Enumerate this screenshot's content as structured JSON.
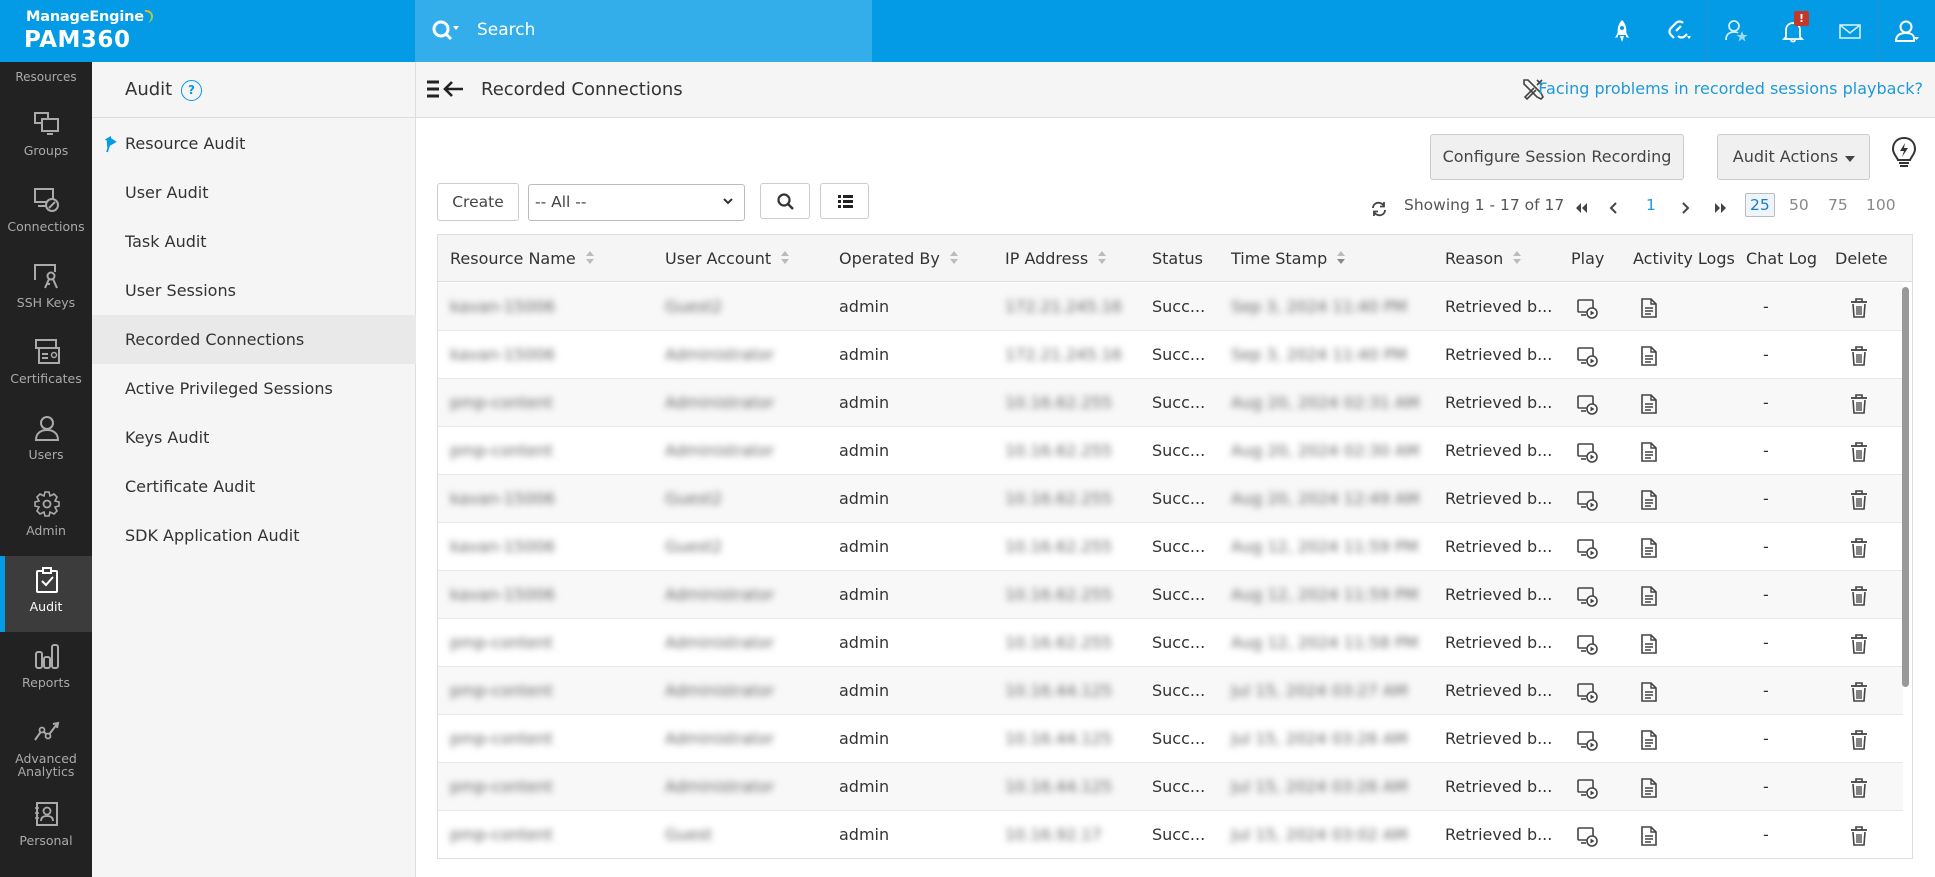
{
  "brand": {
    "vendor": "ManageEngine",
    "product": "PAM360",
    "color": "#039be5"
  },
  "search": {
    "placeholder": "Search"
  },
  "topbar_icons": [
    "rocket-icon",
    "link-icon",
    "user-star-icon",
    "bell-icon",
    "mail-icon",
    "user-icon"
  ],
  "notification_badge": "!",
  "leftnav": {
    "resources_label": "Resources",
    "items": [
      {
        "label": "Groups",
        "icon": "groups-icon"
      },
      {
        "label": "Connections",
        "icon": "connections-icon"
      },
      {
        "label": "SSH Keys",
        "icon": "ssh-keys-icon"
      },
      {
        "label": "Certificates",
        "icon": "certificates-icon"
      },
      {
        "label": "Users",
        "icon": "users-icon"
      },
      {
        "label": "Admin",
        "icon": "admin-gear-icon"
      },
      {
        "label": "Audit",
        "icon": "audit-clipboard-icon",
        "active": true
      },
      {
        "label": "Reports",
        "icon": "reports-icon"
      },
      {
        "label": "Advanced Analytics",
        "icon": "analytics-icon"
      },
      {
        "label": "Personal",
        "icon": "personal-icon"
      }
    ]
  },
  "subnav": {
    "title": "Audit",
    "help": "?",
    "items": [
      {
        "label": "Resource Audit",
        "pinned": true
      },
      {
        "label": "User Audit"
      },
      {
        "label": "Task Audit"
      },
      {
        "label": "User Sessions"
      },
      {
        "label": "Recorded Connections",
        "active": true
      },
      {
        "label": "Active Privileged Sessions"
      },
      {
        "label": "Keys Audit"
      },
      {
        "label": "Certificate Audit"
      },
      {
        "label": "SDK Application Audit"
      }
    ]
  },
  "main": {
    "page_title": "Recorded Connections",
    "help_link": "Facing problems in recorded sessions playback?",
    "configure_button": "Configure Session Recording",
    "audit_actions_button": "Audit Actions",
    "create_button": "Create",
    "filter": {
      "selected": "-- All --"
    },
    "pagination": {
      "showing": "Showing 1 - 17 of 17",
      "current_page": "1",
      "page_sizes": [
        "25",
        "50",
        "75",
        "100"
      ],
      "active_page_size": "25"
    }
  },
  "table": {
    "columns": [
      "Resource Name",
      "User Account",
      "Operated By",
      "IP Address",
      "Status",
      "Time Stamp",
      "Reason",
      "Play",
      "Activity Logs",
      "Chat Log",
      "Delete"
    ],
    "rows": [
      {
        "resource": "kavan-15006",
        "account": "Guest2",
        "operated_by": "admin",
        "ip": "172.21.245.16",
        "status": "Succ...",
        "timestamp": "Sep 3, 2024 11:40 PM",
        "reason": "Retrieved b...",
        "chat": "-"
      },
      {
        "resource": "kavan-15006",
        "account": "Administrator",
        "operated_by": "admin",
        "ip": "172.21.245.16",
        "status": "Succ...",
        "timestamp": "Sep 3, 2024 11:40 PM",
        "reason": "Retrieved b...",
        "chat": "-"
      },
      {
        "resource": "pmp-content",
        "account": "Administrator",
        "operated_by": "admin",
        "ip": "10.16.62.255",
        "status": "Succ...",
        "timestamp": "Aug 20, 2024 02:31 AM",
        "reason": "Retrieved b...",
        "chat": "-"
      },
      {
        "resource": "pmp-content",
        "account": "Administrator",
        "operated_by": "admin",
        "ip": "10.16.62.255",
        "status": "Succ...",
        "timestamp": "Aug 20, 2024 02:30 AM",
        "reason": "Retrieved b...",
        "chat": "-"
      },
      {
        "resource": "kavan-15006",
        "account": "Guest2",
        "operated_by": "admin",
        "ip": "10.16.62.255",
        "status": "Succ...",
        "timestamp": "Aug 20, 2024 12:49 AM",
        "reason": "Retrieved b...",
        "chat": "-"
      },
      {
        "resource": "kavan-15006",
        "account": "Guest2",
        "operated_by": "admin",
        "ip": "10.16.62.255",
        "status": "Succ...",
        "timestamp": "Aug 12, 2024 11:59 PM",
        "reason": "Retrieved b...",
        "chat": "-"
      },
      {
        "resource": "kavan-15006",
        "account": "Administrator",
        "operated_by": "admin",
        "ip": "10.16.62.255",
        "status": "Succ...",
        "timestamp": "Aug 12, 2024 11:59 PM",
        "reason": "Retrieved b...",
        "chat": "-"
      },
      {
        "resource": "pmp-content",
        "account": "Administrator",
        "operated_by": "admin",
        "ip": "10.16.62.255",
        "status": "Succ...",
        "timestamp": "Aug 12, 2024 11:58 PM",
        "reason": "Retrieved b...",
        "chat": "-"
      },
      {
        "resource": "pmp-content",
        "account": "Administrator",
        "operated_by": "admin",
        "ip": "10.16.44.125",
        "status": "Succ...",
        "timestamp": "Jul 15, 2024 03:27 AM",
        "reason": "Retrieved b...",
        "chat": "-"
      },
      {
        "resource": "pmp-content",
        "account": "Administrator",
        "operated_by": "admin",
        "ip": "10.16.44.125",
        "status": "Succ...",
        "timestamp": "Jul 15, 2024 03:26 AM",
        "reason": "Retrieved b...",
        "chat": "-"
      },
      {
        "resource": "pmp-content",
        "account": "Administrator",
        "operated_by": "admin",
        "ip": "10.16.44.125",
        "status": "Succ...",
        "timestamp": "Jul 15, 2024 03:26 AM",
        "reason": "Retrieved b...",
        "chat": "-"
      },
      {
        "resource": "pmp-content",
        "account": "Guest",
        "operated_by": "admin",
        "ip": "10.16.92.17",
        "status": "Succ...",
        "timestamp": "Jul 15, 2024 03:02 AM",
        "reason": "Retrieved b...",
        "chat": "-"
      }
    ]
  }
}
